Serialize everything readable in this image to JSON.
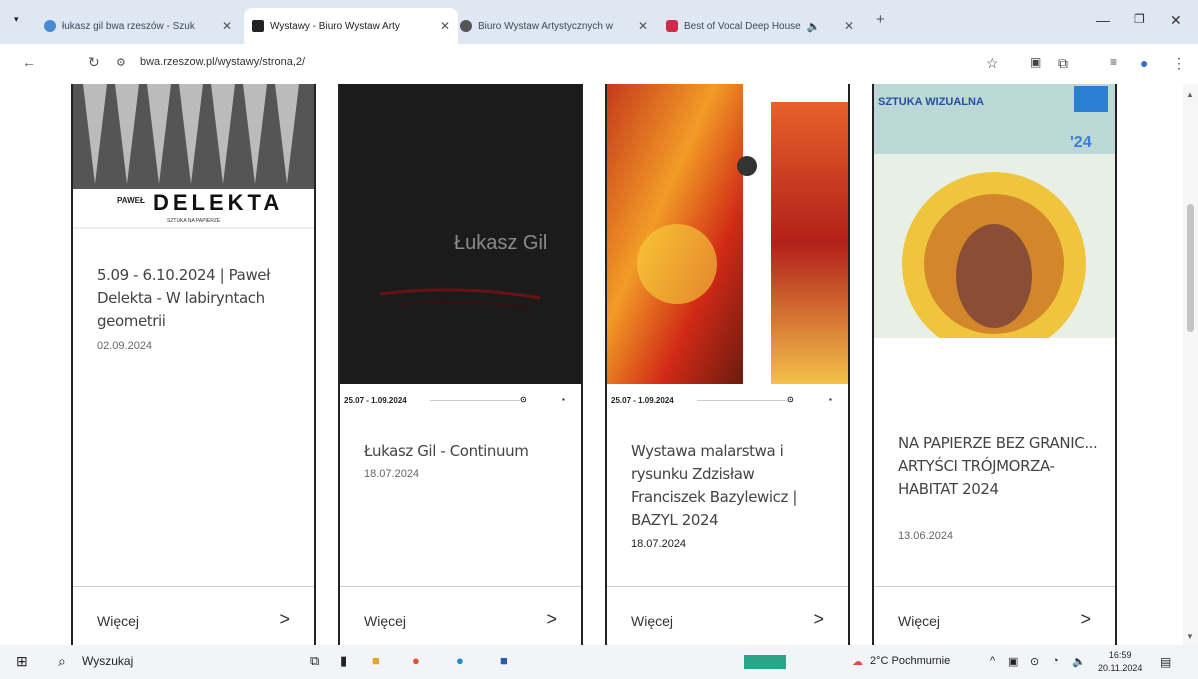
{
  "browser": {
    "tabs": [
      {
        "title": "łukasz gil bwa rzeszów - Szuk",
        "favicon_color": "#4a8ad4"
      },
      {
        "title": "Wystawy - Biuro Wystaw Arty",
        "favicon_color": "#222222"
      },
      {
        "title": "Biuro Wystaw Artystycznych w",
        "favicon_color": "#555555"
      },
      {
        "title": "Best of Vocal Deep House",
        "favicon_color": "#d12b4b"
      }
    ],
    "active_tab_index": 1,
    "new_tab": "+",
    "url": "bwa.rzeszow.pl/wystawy/strona,2/"
  },
  "cards": [
    {
      "poster_name": "PAWEŁ",
      "poster_title": "DELEKTA",
      "poster_sub": "SZTUKA NA PAPIERZE",
      "date_range": "",
      "title": "5.09 - 6.10.2024 | Paweł Delekta - W labiryntach geometrii",
      "date": "02.09.2024",
      "more": "Więcej"
    },
    {
      "poster_text": "Łukasz Gil",
      "date_range": "25.07 - 1.09.2024",
      "title": "Łukasz Gil - Continuum",
      "date": "18.07.2024",
      "more": "Więcej"
    },
    {
      "date_range": "25.07 - 1.09.2024",
      "title": "Wystawa malarstwa i rysunku Zdzisław Franciszek Bazylewicz | BAZYL 2024",
      "date": "18.07.2024",
      "more": "Więcej"
    },
    {
      "poster_text": "SZTUKA WIZUALNA",
      "poster_badge": "'24",
      "date_range": "",
      "title": "NA PAPIERZE BEZ GRANIC... ARTYŚCI TRÓJMORZA-HABITAT 2024",
      "date": "13.06.2024",
      "more": "Więcej"
    }
  ],
  "taskbar": {
    "search": "Wyszukaj",
    "weather": "2°C Pochmurnie",
    "time": "16:59",
    "date": "20.11.2024"
  }
}
